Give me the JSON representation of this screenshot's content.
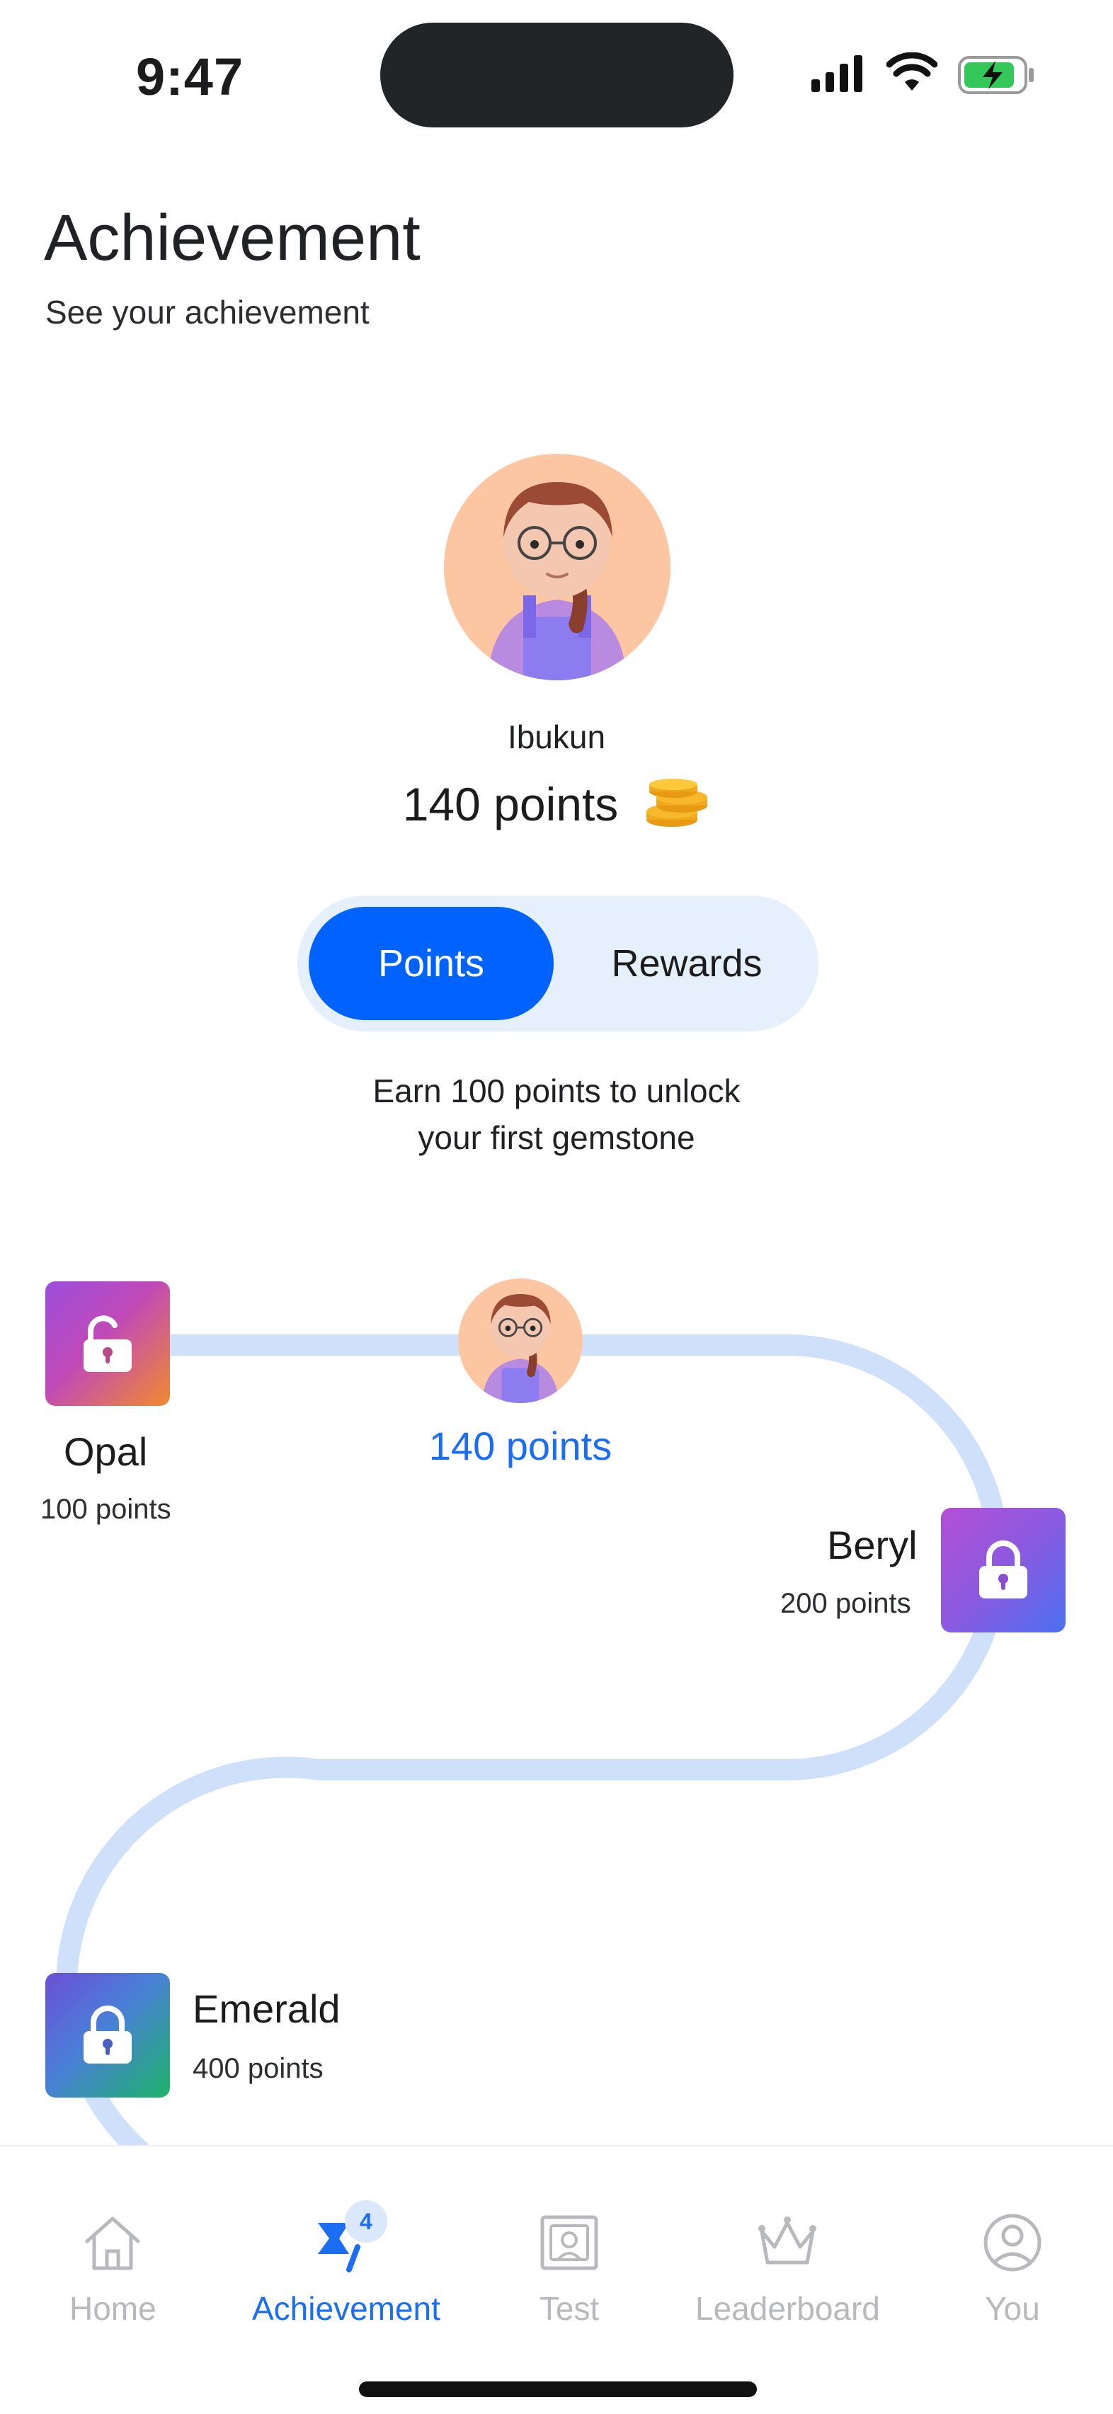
{
  "status_bar": {
    "time": "9:47"
  },
  "header": {
    "title": "Achievement",
    "subtitle": "See your achievement"
  },
  "profile": {
    "username": "Ibukun",
    "points": "140 points"
  },
  "segment": {
    "options": [
      "Points",
      "Rewards"
    ],
    "selected": "Points"
  },
  "hint": {
    "line1": "Earn 100 points to unlock",
    "line2": "your first gemstone"
  },
  "progress": {
    "current_points": "140 points"
  },
  "gemstones": [
    {
      "name": "Opal",
      "points": "100 points",
      "unlocked": true
    },
    {
      "name": "Beryl",
      "points": "200 points",
      "unlocked": false
    },
    {
      "name": "Emerald",
      "points": "400 points",
      "unlocked": false
    }
  ],
  "nav": {
    "items": [
      {
        "label": "Home",
        "icon": "home-icon"
      },
      {
        "label": "Achievement",
        "icon": "achievement-icon",
        "badge": "4",
        "active": true
      },
      {
        "label": "Test",
        "icon": "test-icon"
      },
      {
        "label": "Leaderboard",
        "icon": "crown-icon"
      },
      {
        "label": "You",
        "icon": "profile-icon"
      }
    ]
  },
  "colors": {
    "accent": "#0062FF",
    "accent_text": "#1B6EF3",
    "track": "#CFE0FB",
    "avatar_bg": "#FDC6A2",
    "nav_inactive": "#B7B9BD"
  }
}
